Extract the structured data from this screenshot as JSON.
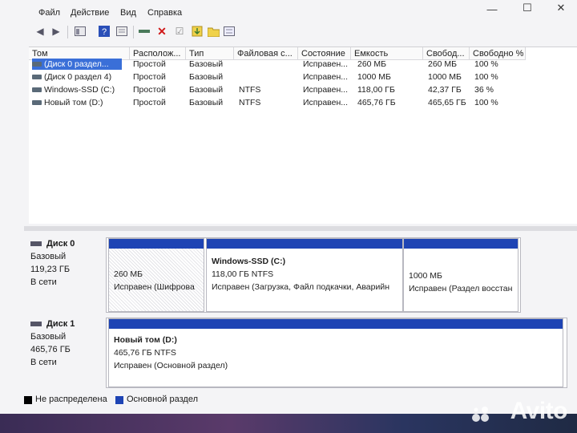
{
  "menu": [
    "Файл",
    "Действие",
    "Вид",
    "Справка"
  ],
  "columns": [
    "Том",
    "Располож...",
    "Тип",
    "Файловая с...",
    "Состояние",
    "Емкость",
    "Свобод...",
    "Свободно %"
  ],
  "volumes": [
    {
      "name": "(Диск 0 раздел...",
      "layout": "Простой",
      "type": "Базовый",
      "fs": "",
      "status": "Исправен...",
      "capacity": "260 МБ",
      "free": "260 МБ",
      "free_pct": "100 %",
      "selected": true
    },
    {
      "name": "(Диск 0 раздел 4)",
      "layout": "Простой",
      "type": "Базовый",
      "fs": "",
      "status": "Исправен...",
      "capacity": "1000 МБ",
      "free": "1000 МБ",
      "free_pct": "100 %",
      "selected": false
    },
    {
      "name": "Windows-SSD (C:)",
      "layout": "Простой",
      "type": "Базовый",
      "fs": "NTFS",
      "status": "Исправен...",
      "capacity": "118,00 ГБ",
      "free": "42,37 ГБ",
      "free_pct": "36 %",
      "selected": false
    },
    {
      "name": "Новый том (D:)",
      "layout": "Простой",
      "type": "Базовый",
      "fs": "NTFS",
      "status": "Исправен...",
      "capacity": "465,76 ГБ",
      "free": "465,65 ГБ",
      "free_pct": "100 %",
      "selected": false
    }
  ],
  "disk0": {
    "title": "Диск 0",
    "type": "Базовый",
    "size": "119,23 ГБ",
    "state": "В сети",
    "partitions": [
      {
        "title": "",
        "size": "260 МБ",
        "status": "Исправен (Шифрова"
      },
      {
        "title": "Windows-SSD  (C:)",
        "size": "118,00 ГБ NTFS",
        "status": "Исправен (Загрузка, Файл подкачки, Аварийн"
      },
      {
        "title": "",
        "size": "1000 МБ",
        "status": "Исправен (Раздел восстан"
      }
    ]
  },
  "disk1": {
    "title": "Диск 1",
    "type": "Базовый",
    "size": "465,76 ГБ",
    "state": "В сети",
    "partition": {
      "title": "Новый том  (D:)",
      "size": "465,76 ГБ NTFS",
      "status": "Исправен (Основной раздел)"
    }
  },
  "legend": {
    "unallocated": "Не распределена",
    "primary": "Основной раздел"
  },
  "colors": {
    "partition_bar": "#1e44b4",
    "selection": "#3a6fd8",
    "unallocated": "#000000",
    "primary": "#1e44b4"
  },
  "watermark": "Avito",
  "icons": [
    "back-arrow-icon",
    "forward-arrow-icon",
    "console-icon",
    "help-icon",
    "properties-icon",
    "connect-icon",
    "delete-icon",
    "check-icon",
    "import-icon",
    "folder-icon",
    "list-icon"
  ]
}
